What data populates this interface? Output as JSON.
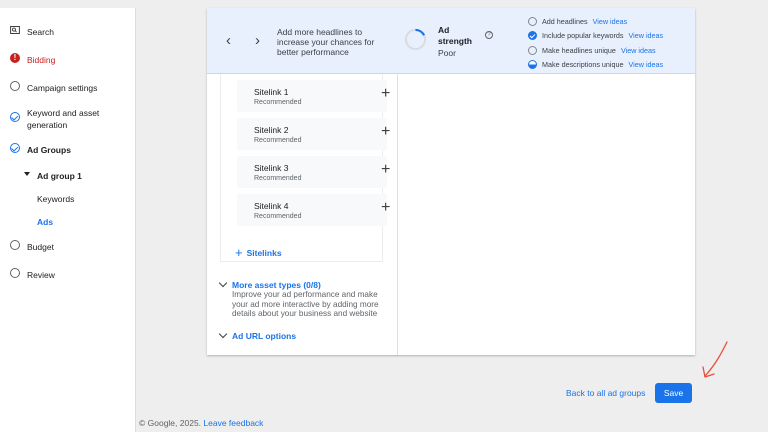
{
  "sidebar": {
    "items": [
      {
        "label": "Search"
      },
      {
        "label": "Bidding"
      },
      {
        "label": "Campaign settings"
      },
      {
        "label": "Keyword and asset generation"
      },
      {
        "label": "Ad Groups"
      },
      {
        "label": "Ad group 1"
      },
      {
        "label": "Keywords"
      },
      {
        "label": "Ads"
      },
      {
        "label": "Budget"
      },
      {
        "label": "Review"
      }
    ]
  },
  "banner": {
    "message": "Add more headlines to increase your chances for better performance",
    "strength_title": "Ad strength",
    "strength_value": "Poor",
    "help_glyph": "?",
    "tips": [
      {
        "label": "Add headlines",
        "link": "View ideas",
        "state": "empty"
      },
      {
        "label": "Include popular keywords",
        "link": "View ideas",
        "state": "done"
      },
      {
        "label": "Make headlines unique",
        "link": "View ideas",
        "state": "empty"
      },
      {
        "label": "Make descriptions unique",
        "link": "View ideas",
        "state": "half"
      }
    ]
  },
  "sitelinks": {
    "items": [
      {
        "title": "Sitelink 1",
        "subtitle": "Recommended"
      },
      {
        "title": "Sitelink 2",
        "subtitle": "Recommended"
      },
      {
        "title": "Sitelink 3",
        "subtitle": "Recommended"
      },
      {
        "title": "Sitelink 4",
        "subtitle": "Recommended"
      }
    ],
    "add_label": "Sitelinks"
  },
  "more_assets": {
    "label": "More asset types (0/8)",
    "description": "Improve your ad performance and make your ad more interactive by adding more details about your business and website"
  },
  "url_options": {
    "label": "Ad URL options"
  },
  "actions": {
    "back_label": "Back to all ad groups",
    "save_label": "Save"
  },
  "footer": {
    "copyright": "© Google, 2025.",
    "feedback": "Leave feedback"
  },
  "colors": {
    "accent": "#1a73e8",
    "error": "#c5221f",
    "banner_bg": "#e8f0fe",
    "annotation": "#e8503a"
  }
}
